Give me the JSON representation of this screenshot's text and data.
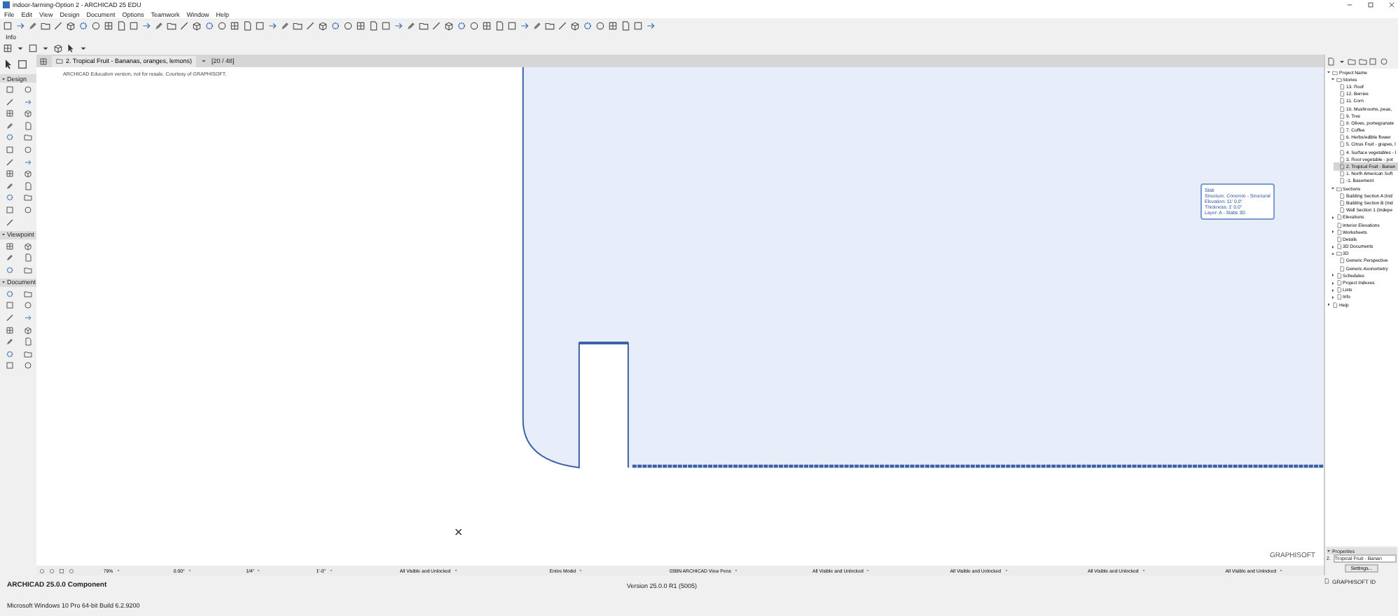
{
  "window": {
    "title": "indoor-farming-Option 2 - ARCHICAD 25 EDU"
  },
  "menu": [
    "File",
    "Edit",
    "View",
    "Design",
    "Document",
    "Options",
    "Teamwork",
    "Window",
    "Help"
  ],
  "info_label": "Info",
  "view_tab": {
    "title": "2. Tropical Fruit - Bananas, oranges, lemons)",
    "count": "[20 / 48]"
  },
  "toolbox": {
    "sections": [
      {
        "title": "Design",
        "expanded": true
      },
      {
        "title": "Viewpoint",
        "expanded": true
      },
      {
        "title": "Document",
        "expanded": true
      }
    ]
  },
  "canvas": {
    "note": "ARCHICAD Education version, not for resale. Courtesy of GRAPHISOFT.",
    "brand": "GRAPHISOFT"
  },
  "tooltip": {
    "lines": [
      "Slab",
      "Structure: Concrete - Structural",
      "Elevation: 11' 0.0\"",
      "Thickness: 1' 0.0\"",
      "Layer: A - Slabs 3D"
    ]
  },
  "status_bar": {
    "fields": [
      "79%",
      "0.00°",
      "1/4\"",
      "1'-0\"",
      "All Visible and Unlocked",
      "Entire Model",
      "03BN ARCHICAD View Pens",
      "All Visible and Unlocked",
      "All Visible and Unlocked",
      "All Visible and Unlocked",
      "All Visible and Unlocked"
    ]
  },
  "navigator": {
    "tree": [
      {
        "label": "Project Name",
        "expanded": true,
        "selected": false,
        "children": [
          {
            "label": "Stories",
            "expanded": true,
            "selected": false,
            "children": [
              {
                "label": "13. Roof",
                "selected": false
              },
              {
                "label": "12. Berries",
                "selected": false
              },
              {
                "label": "11. Corn",
                "selected": false
              },
              {
                "label": "10. Mushrooms, peas,",
                "selected": false
              },
              {
                "label": "9. Tres",
                "selected": false
              },
              {
                "label": "8. Olives, pomegranate",
                "selected": false
              },
              {
                "label": "7. Coffee",
                "selected": false
              },
              {
                "label": "6. Herbs/edible flower",
                "selected": false
              },
              {
                "label": "5. Citrus Fruit - grapes, l",
                "selected": false
              },
              {
                "label": "4. Surface vegetables - l",
                "selected": false
              },
              {
                "label": "3. Root vegetable - pot",
                "selected": false
              },
              {
                "label": "2. Tropical Fruit - Banan",
                "selected": true
              },
              {
                "label": "1. North American Soft",
                "selected": false
              },
              {
                "label": "-1. Basement",
                "selected": false
              }
            ]
          },
          {
            "label": "Sections",
            "expanded": true,
            "selected": false,
            "children": [
              {
                "label": "Building Section A (Ind",
                "selected": false
              },
              {
                "label": "Building Section B (Ind",
                "selected": false
              },
              {
                "label": "Wall Section 1 (Indepe",
                "selected": false
              }
            ]
          },
          {
            "label": "Elevations",
            "expanded": false,
            "selected": false
          },
          {
            "label": "Interior Elevations",
            "selected": false
          },
          {
            "label": "Worksheets",
            "expanded": false,
            "selected": false
          },
          {
            "label": "Details",
            "selected": false
          },
          {
            "label": "3D Documents",
            "expanded": false,
            "selected": false
          },
          {
            "label": "3D",
            "expanded": true,
            "selected": false,
            "children": [
              {
                "label": "Generic Perspective",
                "selected": false
              },
              {
                "label": "Generic Axonometry",
                "selected": false
              }
            ]
          },
          {
            "label": "Schedules",
            "expanded": false,
            "selected": false
          },
          {
            "label": "Project Indexes",
            "expanded": false,
            "selected": false
          },
          {
            "label": "Lists",
            "expanded": false,
            "selected": false
          },
          {
            "label": "Info",
            "expanded": false,
            "selected": false
          }
        ]
      },
      {
        "label": "Help",
        "expanded": false,
        "selected": false
      }
    ]
  },
  "properties": {
    "title": "Properties",
    "id": "2.",
    "name": "Tropical Fruit - Banan",
    "settings": "Settings..."
  },
  "footer": {
    "product": "ARCHICAD 25.0.0 Component",
    "version": "Version 25.0.0 R1 (5005)",
    "os": "Microsoft Windows 10 Pro 64-bit Build 6.2.9200",
    "id": "GRAPHISOFT ID"
  }
}
